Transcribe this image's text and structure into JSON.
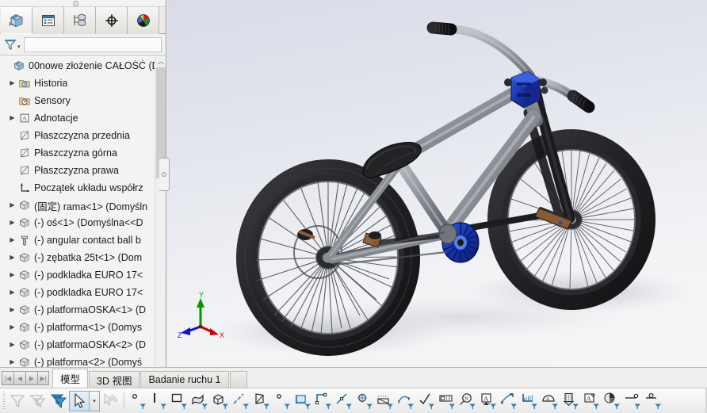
{
  "app": {
    "title": "SolidWorks Assembly",
    "accent": "#2a6fc9"
  },
  "manager_tabs": [
    {
      "name": "feature-manager-tab",
      "icon": "assembly-tree-icon",
      "label": "FeatureManager",
      "active": true
    },
    {
      "name": "property-manager-tab",
      "icon": "property-list-icon",
      "label": "PropertyManager",
      "active": false
    },
    {
      "name": "configuration-manager-tab",
      "icon": "configuration-icon",
      "label": "ConfigurationManager",
      "active": false
    },
    {
      "name": "dimxpert-manager-tab",
      "icon": "crosshair-target-icon",
      "label": "DimXpertManager",
      "active": false
    },
    {
      "name": "display-manager-tab",
      "icon": "color-sphere-icon",
      "label": "DisplayManager",
      "active": false
    }
  ],
  "filter": {
    "icon": "filter-funnel-icon",
    "caret": "▾",
    "value": "",
    "placeholder": ""
  },
  "tree": {
    "root": {
      "label": "00nowe złożenie CAŁOŚĆ  (D",
      "icon": "assembly-icon",
      "has_expander": false
    },
    "items": [
      {
        "label": "Historia",
        "icon": "history-icon",
        "expander": "▶",
        "indent": 1
      },
      {
        "label": "Sensory",
        "icon": "sensors-icon",
        "expander": "",
        "indent": 1
      },
      {
        "label": "Adnotacje",
        "icon": "annotations-icon",
        "expander": "▶",
        "indent": 1
      },
      {
        "label": "Płaszczyzna przednia",
        "icon": "plane-icon",
        "expander": "",
        "indent": 1
      },
      {
        "label": "Płaszczyzna górna",
        "icon": "plane-icon",
        "expander": "",
        "indent": 1
      },
      {
        "label": "Płaszczyzna prawa",
        "icon": "plane-icon",
        "expander": "",
        "indent": 1
      },
      {
        "label": "Początek układu współrz",
        "icon": "origin-icon",
        "expander": "",
        "indent": 1
      },
      {
        "label": "(固定) rama<1> (Domyśln",
        "icon": "part-icon",
        "expander": "▶",
        "indent": 1
      },
      {
        "label": "(-) oś<1> (Domyślna<<D",
        "icon": "part-icon",
        "expander": "▶",
        "indent": 1
      },
      {
        "label": "(-) angular contact ball b",
        "icon": "bolt-icon",
        "expander": "▶",
        "indent": 1
      },
      {
        "label": "(-) zębatka 25t<1> (Dom",
        "icon": "part-icon",
        "expander": "▶",
        "indent": 1
      },
      {
        "label": "(-) podkladka EURO 17<",
        "icon": "part-icon",
        "expander": "▶",
        "indent": 1
      },
      {
        "label": "(-) podkladka EURO 17<",
        "icon": "part-icon",
        "expander": "▶",
        "indent": 1
      },
      {
        "label": "(-) platformaOSKA<1> (D",
        "icon": "part-icon",
        "expander": "▶",
        "indent": 1
      },
      {
        "label": "(-) platforma<1> (Domys",
        "icon": "part-icon",
        "expander": "▶",
        "indent": 1
      },
      {
        "label": "(-) platformaOSKA<2> (D",
        "icon": "part-icon",
        "expander": "▶",
        "indent": 1
      },
      {
        "label": "(-) platforma<2> (Domyś",
        "icon": "part-icon",
        "expander": "▶",
        "indent": 1
      }
    ],
    "scroll_up": "︿",
    "scroll_down": "﹀",
    "scroll_left": "‹",
    "scroll_right": "›"
  },
  "document_tabs": {
    "nav_buttons": [
      {
        "name": "nav-first-button",
        "glyph": "|◀"
      },
      {
        "name": "nav-previous-button",
        "glyph": "◀"
      },
      {
        "name": "nav-next-button",
        "glyph": "▶"
      },
      {
        "name": "nav-last-button",
        "glyph": "▶|"
      }
    ],
    "tabs": [
      {
        "label": "模型",
        "active": true
      },
      {
        "label": "3D 视图",
        "active": false
      },
      {
        "label": "Badanie ruchu 1",
        "active": false
      }
    ]
  },
  "viewport": {
    "triad": {
      "x_label": "X",
      "y_label": "Y",
      "z_label": "Z",
      "x_color": "#cc0000",
      "y_color": "#009900",
      "z_color": "#1010cc"
    },
    "background_top": "#d9dce7",
    "background_bottom": "#f5f5f6",
    "model": {
      "name": "bicycle-assembly",
      "frame_color": "#8d9097",
      "tire_color": "#1b1b1d",
      "hub_accent_color": "#1632a8",
      "pedal_color": "#8a5a36"
    }
  },
  "bottom_toolbar": {
    "items": [
      {
        "name": "filter-clear-button",
        "icon": "funnel-plain-icon",
        "dim": true
      },
      {
        "name": "filter-off-button",
        "icon": "funnel-multi-icon",
        "dim": true
      },
      {
        "name": "filter-all-button",
        "icon": "funnel-stack-icon",
        "dim": false
      },
      {
        "name": "select-tool-button",
        "icon": "arrow-cursor-icon",
        "selected": true,
        "caret": "▾"
      },
      {
        "name": "select-other-button",
        "icon": "arrow-sweep-icon",
        "dim": true
      },
      {
        "name": "filter-vertices-button",
        "icon": "point-filter-icon"
      },
      {
        "name": "filter-edges-button",
        "icon": "edge-filter-icon"
      },
      {
        "name": "filter-faces-button",
        "icon": "face-filter-icon"
      },
      {
        "name": "filter-surface-bodies-button",
        "icon": "surface-filter-icon"
      },
      {
        "name": "filter-solid-bodies-button",
        "icon": "solid-body-filter-icon"
      },
      {
        "name": "filter-axes-button",
        "icon": "axis-filter-icon"
      },
      {
        "name": "filter-planes-button",
        "icon": "plane-filter-icon"
      },
      {
        "name": "filter-sketch-points-button",
        "icon": "sketch-point-filter-icon"
      },
      {
        "name": "filter-sketches-button",
        "icon": "sketch-filter-icon"
      },
      {
        "name": "filter-sketch-segments-button",
        "icon": "sketch-segment-filter-icon"
      },
      {
        "name": "filter-midpoints-button",
        "icon": "midpoint-filter-icon"
      },
      {
        "name": "filter-center-marks-button",
        "icon": "center-mark-filter-icon"
      },
      {
        "name": "filter-centerlines-button",
        "icon": "centerline-filter-icon"
      },
      {
        "name": "filter-dimensions-button",
        "icon": "dimension-filter-icon"
      },
      {
        "name": "filter-surface-finish-button",
        "icon": "surface-finish-filter-icon"
      },
      {
        "name": "filter-notes-button",
        "icon": "note-filter-icon"
      },
      {
        "name": "filter-balloons-button",
        "icon": "balloon-filter-icon"
      },
      {
        "name": "filter-annotations-button",
        "icon": "annotation-filter-icon"
      },
      {
        "name": "filter-leaders-button",
        "icon": "leader-filter-icon"
      },
      {
        "name": "filter-hatch-button",
        "icon": "hatch-filter-icon"
      },
      {
        "name": "filter-datums-button",
        "icon": "datum-filter-icon"
      },
      {
        "name": "filter-weld-symbols-button",
        "icon": "weld-symbol-filter-icon"
      },
      {
        "name": "filter-blocks-button",
        "icon": "block-filter-icon"
      },
      {
        "name": "filter-appearance-button",
        "icon": "appearance-filter-icon"
      },
      {
        "name": "filter-connection-point-button",
        "icon": "connection-point-icon"
      },
      {
        "name": "filter-route-point-button",
        "icon": "route-point-icon"
      }
    ]
  }
}
